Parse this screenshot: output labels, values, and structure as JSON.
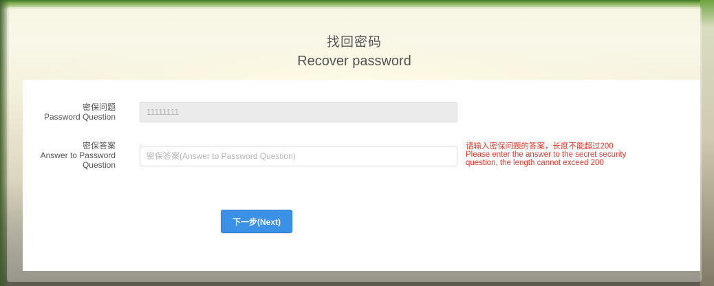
{
  "header": {
    "title_cn": "找回密码",
    "title_en": "Recover password"
  },
  "form": {
    "question": {
      "label_cn": "密保问题",
      "label_en": "Password Question",
      "value": "11111111"
    },
    "answer": {
      "label_cn": "密保答案",
      "label_en_line1": "Answer to Password",
      "label_en_line2": "Question",
      "placeholder": "密保答案(Answer to Password Question)",
      "value": "",
      "error_cn": "请输入密保问题的答案，长度不能超过200",
      "error_en": "Please enter the answer to the secret security question, the length cannot exceed 200"
    },
    "next_label": "下一步(Next)"
  },
  "colors": {
    "accent": "#3a91e6",
    "error": "#e23b2e"
  }
}
